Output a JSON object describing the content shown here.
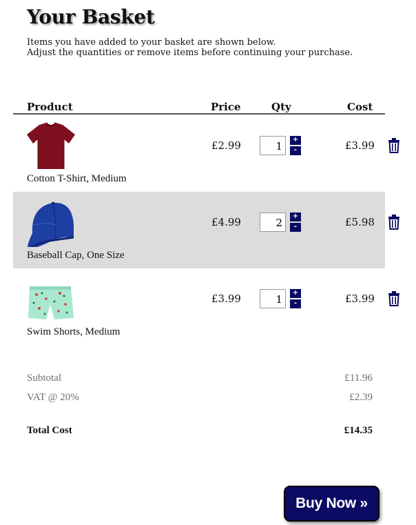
{
  "page": {
    "title": "Your Basket",
    "intro_line1": "Items you have added to your basket are shown below.",
    "intro_line2": "Adjust the quantities or remove items before continuing your purchase."
  },
  "table": {
    "headers": {
      "product": "Product",
      "price": "Price",
      "qty": "Qty",
      "cost": "Cost"
    }
  },
  "items": [
    {
      "name": "Cotton T-Shirt, Medium",
      "price": "£2.99",
      "qty": "1",
      "cost": "£3.99",
      "image_icon": "tshirt-image",
      "color": "#7e0f1e"
    },
    {
      "name": "Baseball Cap, One Size",
      "price": "£4.99",
      "qty": "2",
      "cost": "£5.98",
      "image_icon": "baseball-cap-image",
      "color": "#1d3ea3"
    },
    {
      "name": "Swim Shorts, Medium",
      "price": "£3.99",
      "qty": "1",
      "cost": "£3.99",
      "image_icon": "swim-shorts-image",
      "color": "#a7e8cf"
    }
  ],
  "stepper": {
    "plus": "+",
    "minus": "-"
  },
  "summary": {
    "subtotal_label": "Subtotal",
    "subtotal_value": "£11.96",
    "vat_label": "VAT @ 20%",
    "vat_value": "£2.39",
    "total_label": "Total Cost",
    "total_value": "£14.35"
  },
  "buy_button": {
    "label": "Buy Now »"
  },
  "colors": {
    "accent": "#0b0b63",
    "row_shade": "#dcdcdc",
    "muted_text": "#6e6e6e"
  }
}
